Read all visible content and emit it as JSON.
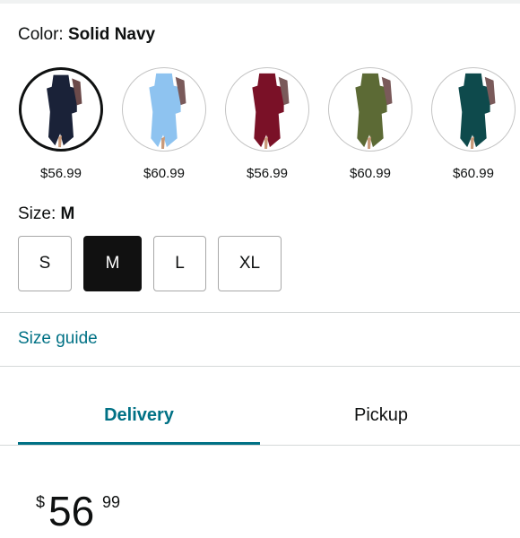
{
  "color": {
    "label": "Color: ",
    "value": "Solid Navy",
    "options": [
      {
        "name": "Solid Navy",
        "price": "$56.99",
        "dress_color": "#1a2238",
        "selected": true
      },
      {
        "name": "Light Blue",
        "price": "$60.99",
        "dress_color": "#8ec3f0",
        "selected": false
      },
      {
        "name": "Wine Red",
        "price": "$56.99",
        "dress_color": "#7a1127",
        "selected": false
      },
      {
        "name": "Olive Green",
        "price": "$60.99",
        "dress_color": "#5c6a35",
        "selected": false
      },
      {
        "name": "Dark Teal",
        "price": "$60.99",
        "dress_color": "#0e4a4c",
        "selected": false
      }
    ]
  },
  "size": {
    "label": "Size: ",
    "value": "M",
    "options": [
      "S",
      "M",
      "L",
      "XL"
    ],
    "selected": "M"
  },
  "size_guide": "Size guide",
  "tabs": [
    {
      "label": "Delivery",
      "active": true
    },
    {
      "label": "Pickup",
      "active": false
    }
  ],
  "price": {
    "symbol": "$",
    "whole": "56",
    "fraction": "99"
  },
  "colors": {
    "accent": "#007185",
    "selected_bg": "#111111",
    "divider": "#d5d9d9"
  }
}
